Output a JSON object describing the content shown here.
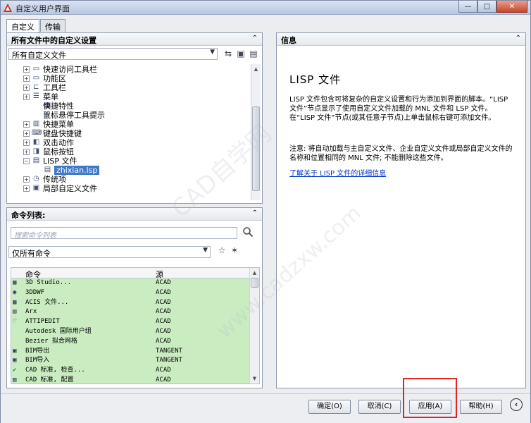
{
  "window": {
    "title": "自定义用户界面",
    "minimize": "—",
    "maximize": "□",
    "close": "✕"
  },
  "tabs": [
    {
      "label": "自定义"
    },
    {
      "label": "传输"
    }
  ],
  "left_top": {
    "header": "所有文件中的自定义设置",
    "combo_value": "所有自定义文件",
    "tree": [
      {
        "label": "快速访问工具栏",
        "icon": "toolbar-icon"
      },
      {
        "label": "功能区",
        "icon": "ribbon-icon"
      },
      {
        "label": "工具栏",
        "icon": "toolbar-icon"
      },
      {
        "label": "菜单",
        "icon": "menu-icon"
      },
      {
        "label": "快捷特性",
        "icon": "properties-icon"
      },
      {
        "label": "鼠标悬停工具提示",
        "icon": "tooltip-icon"
      },
      {
        "label": "快捷菜单",
        "icon": "shortcut-menu-icon"
      },
      {
        "label": "键盘快捷键",
        "icon": "keyboard-icon"
      },
      {
        "label": "双击动作",
        "icon": "double-click-icon"
      },
      {
        "label": "鼠标按钮",
        "icon": "mouse-icon"
      },
      {
        "label": "LISP 文件",
        "icon": "lisp-folder-icon"
      },
      {
        "label": "zhixian.lsp",
        "icon": "lsp-file-icon"
      },
      {
        "label": "传统项",
        "icon": "legacy-icon"
      },
      {
        "label": "局部自定义文件",
        "icon": "partial-file-icon"
      }
    ]
  },
  "left_bottom": {
    "header": "命令列表:",
    "search_placeholder": "搜索命令列表",
    "filter_value": "仅所有命令",
    "col_command": "命令",
    "col_source": "源",
    "rows": [
      {
        "name": "3D Studio...",
        "source": "ACAD"
      },
      {
        "name": "3DDWF",
        "source": "ACAD"
      },
      {
        "name": "ACIS 文件...",
        "source": "ACAD"
      },
      {
        "name": "Arx",
        "source": "ACAD"
      },
      {
        "name": "ATTIPEDIT",
        "source": "ACAD"
      },
      {
        "name": "Autodesk 国际用户组",
        "source": "ACAD"
      },
      {
        "name": "Bezier 拟合网格",
        "source": "ACAD"
      },
      {
        "name": "BIM导出",
        "source": "TANGENT"
      },
      {
        "name": "BIM导入",
        "source": "TANGENT"
      },
      {
        "name": "CAD 标准, 检查...",
        "source": "ACAD"
      },
      {
        "name": "CAD 标准, 配置",
        "source": "ACAD"
      }
    ]
  },
  "right_panel": {
    "header": "信息",
    "title": "LISP 文件",
    "para1": "LISP 文件包含可将复杂的自定义设置和行为添加到界面的脚本。“LISP 文件”节点显示了使用自定义文件加载的 MNL 文件和 LSP 文件。在“LISP 文件”节点(或其任意子节点)上单击鼠标右键可添加文件。",
    "para2": "注意: 将自动加载与主自定义文件、企业自定义文件或局部自定义文件的名称和位置相同的 MNL 文件; 不能删除这些文件。",
    "link": "了解关于 LISP 文件的详细信息"
  },
  "buttons": {
    "ok": "确定(O)",
    "cancel": "取消(C)",
    "apply": "应用(A)",
    "help": "帮助(H)"
  },
  "watermark": {
    "line1": "CAD自学网",
    "line2": "www.cadzxw.com"
  }
}
